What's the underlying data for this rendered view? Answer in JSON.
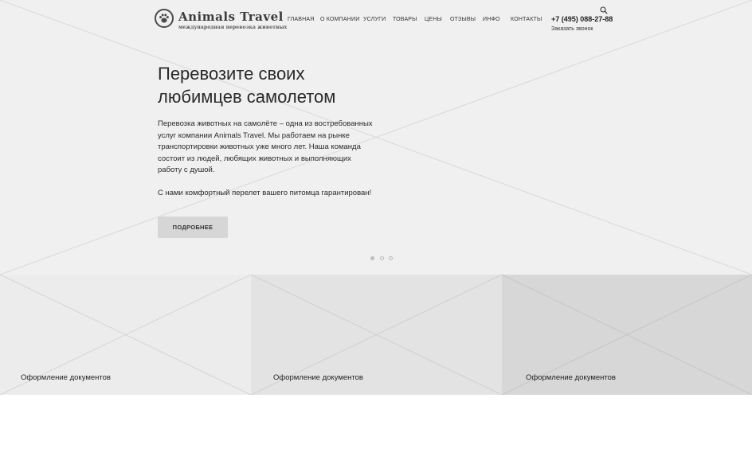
{
  "header": {
    "logo_title": "Animals Travel",
    "logo_subtitle": "международная перевозка животных",
    "nav": [
      "ГЛАВНАЯ",
      "О КОМПАНИИ",
      "УСЛУГИ",
      "ТОВАРЫ",
      "ЦЕНЫ",
      "ОТЗЫВЫ",
      "ИНФО",
      "КОНТАКТЫ"
    ],
    "phone": "+7 (495) 088-27-88",
    "callback": "Заказать звонок",
    "search_icon": "search-icon"
  },
  "hero": {
    "title_line1": "Перевозите своих",
    "title_line2": "любимцев самолетом",
    "paragraph1": "Перевозка животных на самолёте – одна из востребованных услуг компании Animals Travel. Мы работаем на рынке транспортировки животных уже много лет. Наша команда состоит из людей, любящих животных и выполняющих работу с душой.",
    "paragraph2": "С нами комфортный перелет вашего питомца гарантирован!",
    "button_label": "ПОДРОБНЕЕ",
    "slides": {
      "count": 3,
      "active": 1
    }
  },
  "tiles": [
    {
      "label": "Оформление документов"
    },
    {
      "label": "Оформление документов"
    },
    {
      "label": "Оформление документов"
    }
  ],
  "colors": {
    "hero_bg": "#f0f0f0",
    "tile_1": "#ececec",
    "tile_2": "#e3e3e3",
    "tile_3": "#d7d7d7",
    "button_bg": "#d6d6d6"
  }
}
